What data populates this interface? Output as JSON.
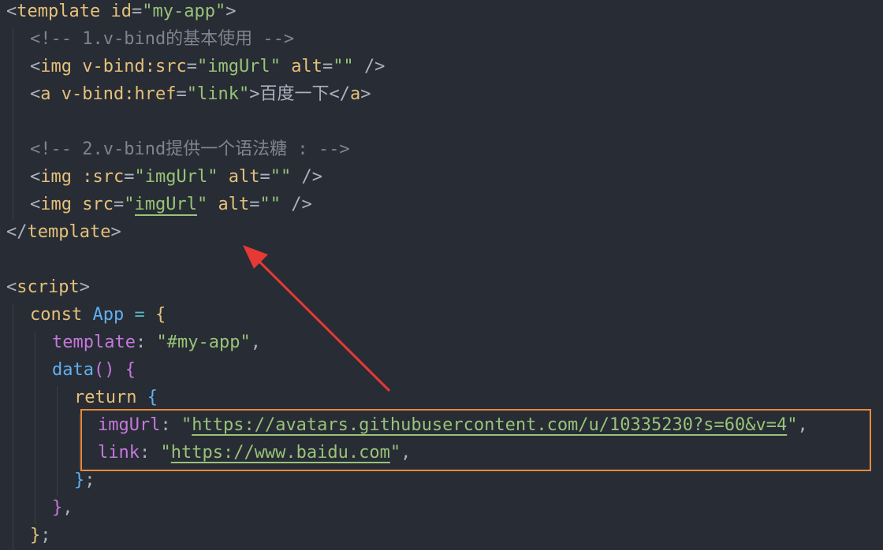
{
  "code": {
    "template_open": {
      "tag": "template",
      "attr": "id",
      "value": "my-app"
    },
    "comment1": "<!-- 1.v-bind的基本使用 -->",
    "img1": {
      "tag": "img",
      "attr": "v-bind:src",
      "value": "imgUrl",
      "alt_attr": "alt",
      "alt_value": ""
    },
    "link_el": {
      "tag": "a",
      "attr": "v-bind:href",
      "value": "link",
      "text": "百度一下"
    },
    "comment2": "<!-- 2.v-bind提供一个语法糖 : -->",
    "img2": {
      "tag": "img",
      "attr": ":src",
      "value": "imgUrl",
      "alt_attr": "alt",
      "alt_value": ""
    },
    "img3": {
      "tag": "img",
      "attr": "src",
      "value": "imgUrl",
      "alt_attr": "alt",
      "alt_value": ""
    },
    "template_close": "template",
    "script_open": "script",
    "const_kw": "const",
    "app_name": "App",
    "template_prop": "template",
    "template_val": "#my-app",
    "data_fn": "data",
    "return_kw": "return",
    "imgUrl_key": "imgUrl",
    "imgUrl_val": "https://avatars.githubusercontent.com/u/10335230?s=60&v=4",
    "link_key": "link",
    "link_val": "https://www.baidu.com"
  },
  "annotation": {
    "highlight_color": "#e88a3c",
    "arrow_color": "#e53935"
  }
}
